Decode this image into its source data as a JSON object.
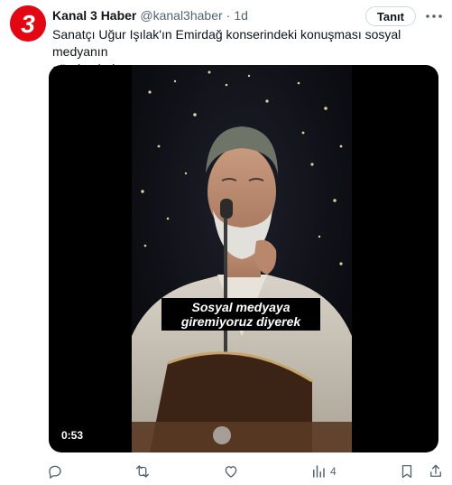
{
  "account": {
    "display_name": "Kanal 3 Haber",
    "handle": "@kanal3haber",
    "separator": "·",
    "time": "1d",
    "avatar_text": "3",
    "brand_color": "#e30613"
  },
  "follow_button": {
    "label": "Tanıt"
  },
  "tweet": {
    "text": "Sanatçı  Uğur Işılak'ın Emirdağ konserindeki konuşması sosyal medyanın\ngündeminde..."
  },
  "media": {
    "subtitle": "Sosyal medyaya\ngiremiyoruz diyerek",
    "duration": "0:53"
  },
  "actions": {
    "reply_icon": "reply-icon",
    "retweet_icon": "retweet-icon",
    "like_icon": "like-icon",
    "views_icon": "views-icon",
    "views_count": "4",
    "bookmark_icon": "bookmark-icon",
    "share_icon": "share-icon"
  },
  "colors": {
    "text_primary": "#0f1419",
    "text_secondary": "#536471",
    "border": "#cfd9de"
  }
}
